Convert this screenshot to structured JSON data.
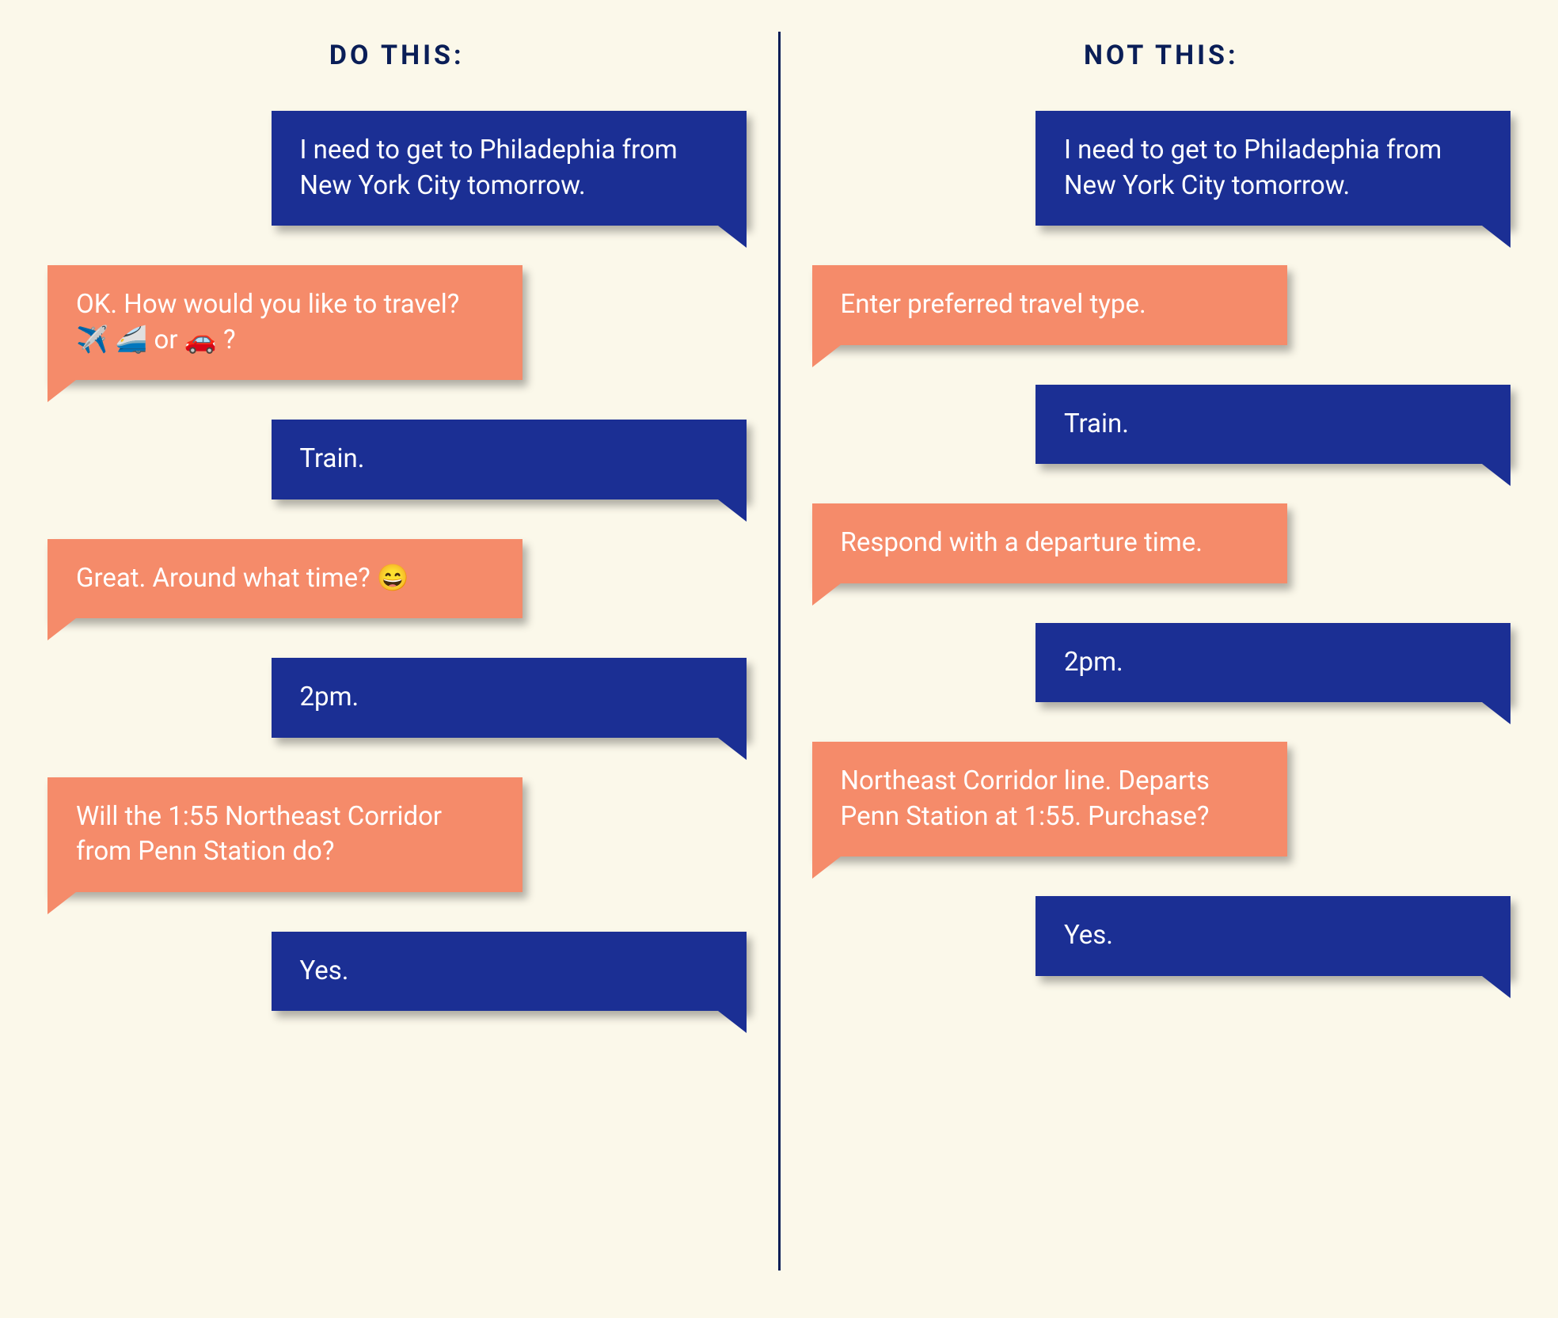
{
  "headings": {
    "do": "DO THIS:",
    "not": "NOT THIS:"
  },
  "left": {
    "msg1": "I need to get to Philadephia from New York City tomorrow.",
    "msg2": "OK. How would you like to travel? ✈️ 🚄 or 🚗 ?",
    "msg3": "Train.",
    "msg4": "Great. Around what time? 😄",
    "msg5": "2pm.",
    "msg6": "Will the 1:55 Northeast Corridor from Penn Station do?",
    "msg7": "Yes."
  },
  "right": {
    "msg1": "I need to get to Philadephia from New York City tomorrow.",
    "msg2": "Enter preferred travel type.",
    "msg3": "Train.",
    "msg4": "Respond with a departure time.",
    "msg5": "2pm.",
    "msg6": "Northeast Corridor line. Departs Penn Station at 1:55. Purchase?",
    "msg7": "Yes."
  },
  "colors": {
    "user_bubble": "#1b2f94",
    "bot_bubble": "#f58b6a",
    "background": "#fbf8ea",
    "heading": "#0a1e57"
  }
}
